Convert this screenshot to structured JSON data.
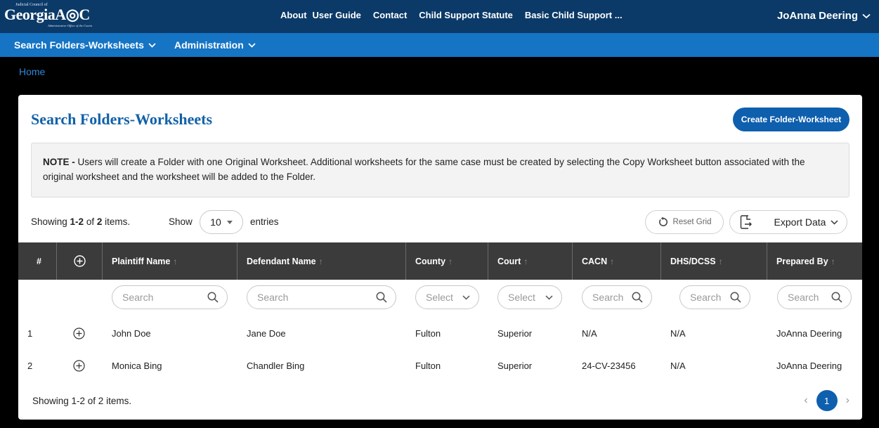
{
  "header": {
    "logo": {
      "small_text": "Judicial Council of",
      "main_text": "GeorgiaA◎C",
      "sub_text": "Administrative Office of the Courts"
    },
    "links": [
      "About",
      "User Guide",
      "Contact",
      "Child Support Statute",
      "Basic Child Support ..."
    ],
    "user_name": "JoAnna Deering"
  },
  "nav": {
    "items": [
      "Search Folders-Worksheets",
      "Administration"
    ]
  },
  "breadcrumb": {
    "home": "Home"
  },
  "main": {
    "title": "Search Folders-Worksheets",
    "create_button": "Create Folder-Worksheet",
    "note_label": "NOTE -",
    "note_text": " Users will create a Folder with one Original Worksheet. Additional worksheets for the same case must be created by selecting the Copy Worksheet button associated with the original worksheet and the worksheet will be added to the Folder."
  },
  "toolbar": {
    "showing_prefix": "Showing ",
    "showing_range": "1-2",
    "showing_mid": " of ",
    "showing_total": "2",
    "showing_suffix": " items.",
    "show_label": "Show",
    "page_size": "10",
    "entries_label": "entries",
    "reset_label": "Reset Grid",
    "export_label": "Export Data"
  },
  "grid": {
    "columns": [
      "#",
      "",
      "Plaintiff Name",
      "Defendant Name",
      "County",
      "Court",
      "CACN",
      "DHS/DCSS",
      "Prepared By"
    ],
    "search_placeholder": "Search",
    "select_placeholder": "Select",
    "rows": [
      {
        "num": "1",
        "plaintiff": "John Doe",
        "defendant": "Jane Doe",
        "county": "Fulton",
        "court": "Superior",
        "cacn": "N/A",
        "dhs": "N/A",
        "prepared": "JoAnna Deering"
      },
      {
        "num": "2",
        "plaintiff": "Monica Bing",
        "defendant": "Chandler Bing",
        "county": "Fulton",
        "court": "Superior",
        "cacn": "24-CV-23456",
        "dhs": "N/A",
        "prepared": "JoAnna Deering"
      }
    ]
  },
  "footer": {
    "showing": "Showing 1-2 of 2 items.",
    "current_page": "1"
  },
  "colors": {
    "header_bg": "#0b3a68",
    "nav_bg": "#1574c4",
    "accent": "#0e5fae",
    "grid_header": "#3b3b3b"
  }
}
